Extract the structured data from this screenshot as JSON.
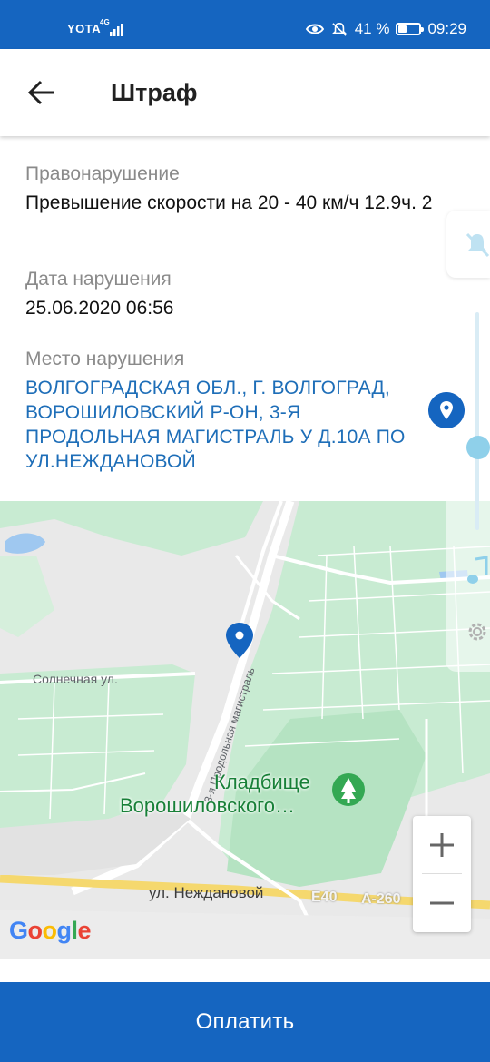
{
  "status_bar": {
    "carrier": "YOTA",
    "network": "4G",
    "battery_text": "41 %",
    "battery_level": 0.41,
    "time": "09:29"
  },
  "app_bar": {
    "back_icon": "arrow-left-icon",
    "title": "Штраф"
  },
  "violation": {
    "offense_label": "Правонарушение",
    "offense_value": "Превышение скорости на 20 - 40 км/ч 12.9ч. 2",
    "date_label": "Дата нарушения",
    "date_value": "25.06.2020 06:56",
    "place_label": "Место нарушения",
    "place_value": "ВОЛГОГРАДСКАЯ ОБЛ., Г. ВОЛГОГРАД, ВОРОШИЛОВСКИЙ Р-ОН, 3-Я ПРОДОЛЬНАЯ МАГИСТРАЛЬ У Д.10А ПО УЛ.НЕЖДАНОВОЙ"
  },
  "map": {
    "street_solnechnaya": "Солнечная ул.",
    "street_prodolnaya": "3-я Продольная магистраль",
    "cemetery_line1": "Кладбище",
    "cemetery_line2": "Ворошиловского…",
    "street_nezhdanovoy": "ул. Неждановой",
    "shield_e40": "E40",
    "shield_a260": "A-260",
    "zoom_in": "+",
    "zoom_out": "−",
    "attribution": "Google",
    "colors": {
      "park": "#c8ebd2",
      "road": "#ffffff",
      "water": "#9fc8f0",
      "highway": "#f5d86e",
      "pin": "#1565c0"
    }
  },
  "actions": {
    "pay_label": "Оплатить"
  },
  "colors": {
    "primary": "#1565c0",
    "link": "#1e6eb8",
    "label": "#8a8a8a"
  }
}
